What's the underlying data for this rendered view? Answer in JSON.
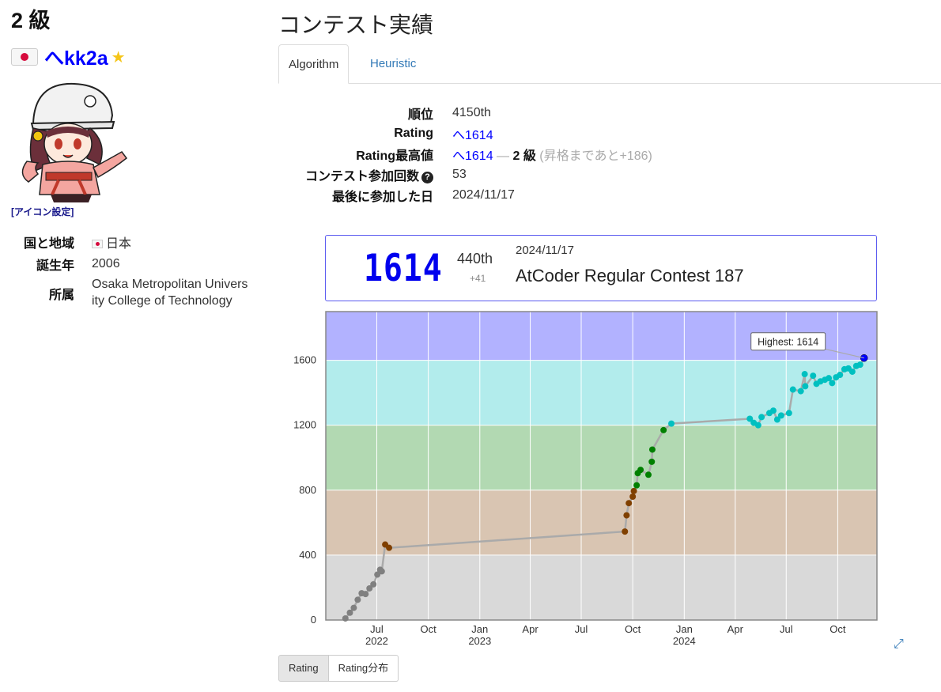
{
  "profile": {
    "kyu": "2 級",
    "username": "へkk2a",
    "star": "★",
    "icon_setting": "[アイコン設定]",
    "info": [
      {
        "key": "国と地域",
        "value": "日本",
        "flag": true
      },
      {
        "key": "誕生年",
        "value": "2006",
        "flag": false
      },
      {
        "key": "所属",
        "value": "Osaka Metropolitan University College of Technology",
        "flag": false
      }
    ]
  },
  "page": {
    "title": "コンテスト実績",
    "tabs": [
      "Algorithm",
      "Heuristic"
    ]
  },
  "stats": {
    "rank_label": "順位",
    "rank": "4150th",
    "rating_label": "Rating",
    "rating": "へ1614",
    "max_label": "Rating最高値",
    "max": "へ1614",
    "max_dash": " — ",
    "max_kyu": "2 級",
    "max_note": " (昇格まであと+186)",
    "count_label": "コンテスト参加回数",
    "count_icon": "?",
    "count": "53",
    "last_label": "最後に参加した日",
    "last": "2024/11/17"
  },
  "last_contest": {
    "rating": "1614",
    "rank": "440th",
    "diff": "+41",
    "date": "2024/11/17",
    "name": "AtCoder Regular Contest 187"
  },
  "buttons": {
    "rating": "Rating",
    "dist": "Rating分布"
  },
  "colors": {
    "gray": "#D9D9D9",
    "brown": "#D9C5B2",
    "green": "#B2D9B2",
    "cyan": "#B2ECEC",
    "blue": "#B2B2FF",
    "dot_gray": "#808080",
    "dot_brown": "#804000",
    "dot_green": "#008000",
    "dot_cyan": "#00C0C0",
    "dot_blue": "#0000FF",
    "accent": "#0000FF"
  },
  "chart_data": {
    "type": "line",
    "ylim": [
      0,
      1900
    ],
    "yticks": [
      0,
      400,
      800,
      1200,
      1600
    ],
    "x_range": [
      "2022-04-01",
      "2024-12-10"
    ],
    "xticks": [
      {
        "date": "2022-07-01",
        "label": "Jul",
        "year": "2022"
      },
      {
        "date": "2022-10-01",
        "label": "Oct",
        "year": ""
      },
      {
        "date": "2023-01-01",
        "label": "Jan",
        "year": "2023"
      },
      {
        "date": "2023-04-01",
        "label": "Apr",
        "year": ""
      },
      {
        "date": "2023-07-01",
        "label": "Jul",
        "year": ""
      },
      {
        "date": "2023-10-01",
        "label": "Oct",
        "year": ""
      },
      {
        "date": "2024-01-01",
        "label": "Jan",
        "year": "2024"
      },
      {
        "date": "2024-04-01",
        "label": "Apr",
        "year": ""
      },
      {
        "date": "2024-07-01",
        "label": "Jul",
        "year": ""
      },
      {
        "date": "2024-10-01",
        "label": "Oct",
        "year": ""
      }
    ],
    "bands": [
      {
        "from": 0,
        "to": 400,
        "color": "gray"
      },
      {
        "from": 400,
        "to": 800,
        "color": "brown"
      },
      {
        "from": 800,
        "to": 1200,
        "color": "green"
      },
      {
        "from": 1200,
        "to": 1600,
        "color": "cyan"
      },
      {
        "from": 1600,
        "to": 1900,
        "color": "blue"
      }
    ],
    "highest_label": "Highest: 1614",
    "points": [
      {
        "x": "2022-05-06",
        "y": 10
      },
      {
        "x": "2022-05-14",
        "y": 45
      },
      {
        "x": "2022-05-21",
        "y": 75
      },
      {
        "x": "2022-05-28",
        "y": 125
      },
      {
        "x": "2022-06-04",
        "y": 165
      },
      {
        "x": "2022-06-11",
        "y": 160
      },
      {
        "x": "2022-06-18",
        "y": 195
      },
      {
        "x": "2022-06-25",
        "y": 220
      },
      {
        "x": "2022-07-02",
        "y": 280
      },
      {
        "x": "2022-07-07",
        "y": 310
      },
      {
        "x": "2022-07-10",
        "y": 300
      },
      {
        "x": "2022-07-16",
        "y": 465
      },
      {
        "x": "2022-07-23",
        "y": 445
      },
      {
        "x": "2023-09-17",
        "y": 545
      },
      {
        "x": "2023-09-20",
        "y": 645
      },
      {
        "x": "2023-09-24",
        "y": 720
      },
      {
        "x": "2023-10-01",
        "y": 760
      },
      {
        "x": "2023-10-03",
        "y": 795
      },
      {
        "x": "2023-10-08",
        "y": 830
      },
      {
        "x": "2023-10-10",
        "y": 905
      },
      {
        "x": "2023-10-15",
        "y": 925
      },
      {
        "x": "2023-10-29",
        "y": 895
      },
      {
        "x": "2023-11-04",
        "y": 975
      },
      {
        "x": "2023-11-05",
        "y": 1050
      },
      {
        "x": "2023-11-25",
        "y": 1170
      },
      {
        "x": "2023-12-09",
        "y": 1210
      },
      {
        "x": "2024-04-27",
        "y": 1240
      },
      {
        "x": "2024-05-04",
        "y": 1215
      },
      {
        "x": "2024-05-12",
        "y": 1200
      },
      {
        "x": "2024-05-18",
        "y": 1250
      },
      {
        "x": "2024-06-01",
        "y": 1275
      },
      {
        "x": "2024-06-08",
        "y": 1290
      },
      {
        "x": "2024-06-15",
        "y": 1235
      },
      {
        "x": "2024-06-22",
        "y": 1260
      },
      {
        "x": "2024-07-06",
        "y": 1275
      },
      {
        "x": "2024-07-13",
        "y": 1420
      },
      {
        "x": "2024-07-27",
        "y": 1410
      },
      {
        "x": "2024-08-03",
        "y": 1515
      },
      {
        "x": "2024-08-04",
        "y": 1440
      },
      {
        "x": "2024-08-18",
        "y": 1505
      },
      {
        "x": "2024-08-24",
        "y": 1455
      },
      {
        "x": "2024-08-31",
        "y": 1470
      },
      {
        "x": "2024-09-08",
        "y": 1480
      },
      {
        "x": "2024-09-15",
        "y": 1490
      },
      {
        "x": "2024-09-21",
        "y": 1460
      },
      {
        "x": "2024-09-28",
        "y": 1495
      },
      {
        "x": "2024-10-05",
        "y": 1510
      },
      {
        "x": "2024-10-13",
        "y": 1545
      },
      {
        "x": "2024-10-20",
        "y": 1550
      },
      {
        "x": "2024-10-27",
        "y": 1530
      },
      {
        "x": "2024-11-03",
        "y": 1565
      },
      {
        "x": "2024-11-10",
        "y": 1573
      },
      {
        "x": "2024-11-17",
        "y": 1614
      }
    ]
  }
}
